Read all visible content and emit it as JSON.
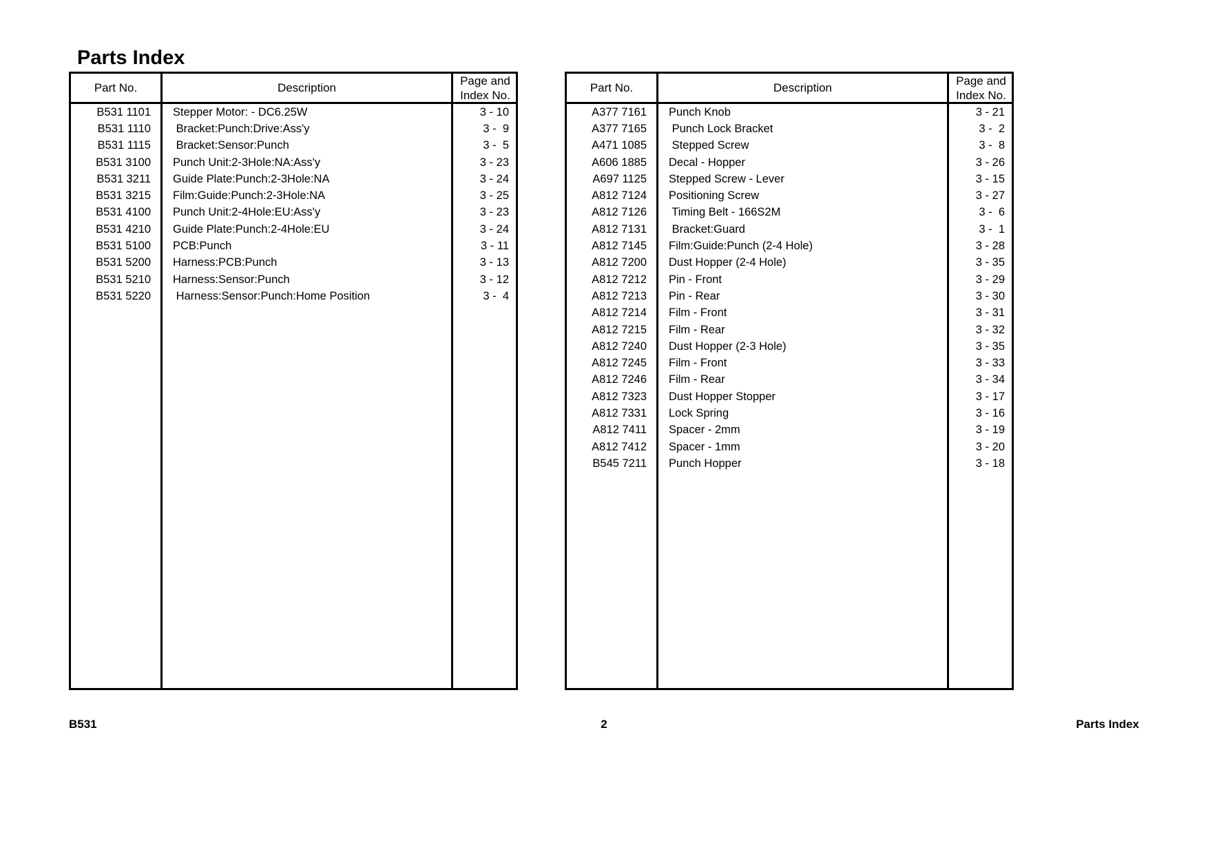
{
  "document": {
    "title": "Parts Index"
  },
  "table_headers": {
    "part_no": "Part No.",
    "description": "Description",
    "page_and_index_line1": "Page and",
    "page_and_index_line2": "Index No."
  },
  "left_table": {
    "rows": [
      {
        "part_no": "B531 1101",
        "description": "Stepper Motor: - DC6.25W",
        "page_index": "3 - 10"
      },
      {
        "part_no": "B531 1110",
        "description": " Bracket:Punch:Drive:Ass'y",
        "page_index": "3 -  9"
      },
      {
        "part_no": "B531 1115",
        "description": " Bracket:Sensor:Punch",
        "page_index": "3 -  5"
      },
      {
        "part_no": "B531 3100",
        "description": "Punch Unit:2-3Hole:NA:Ass'y",
        "page_index": "3 - 23"
      },
      {
        "part_no": "B531 3211",
        "description": "Guide Plate:Punch:2-3Hole:NA",
        "page_index": "3 - 24"
      },
      {
        "part_no": "B531 3215",
        "description": "Film:Guide:Punch:2-3Hole:NA",
        "page_index": "3 - 25"
      },
      {
        "part_no": "B531 4100",
        "description": "Punch Unit:2-4Hole:EU:Ass'y",
        "page_index": "3 - 23"
      },
      {
        "part_no": "B531 4210",
        "description": "Guide Plate:Punch:2-4Hole:EU",
        "page_index": "3 - 24"
      },
      {
        "part_no": "B531 5100",
        "description": "PCB:Punch",
        "page_index": "3 - 11"
      },
      {
        "part_no": "B531 5200",
        "description": "Harness:PCB:Punch",
        "page_index": "3 - 13"
      },
      {
        "part_no": "B531 5210",
        "description": "Harness:Sensor:Punch",
        "page_index": "3 - 12"
      },
      {
        "part_no": "B531 5220",
        "description": " Harness:Sensor:Punch:Home Position",
        "page_index": "3 -  4"
      }
    ]
  },
  "right_table": {
    "rows": [
      {
        "part_no": "A377 7161",
        "description": "Punch Knob",
        "page_index": "3 - 21"
      },
      {
        "part_no": "A377 7165",
        "description": " Punch Lock Bracket",
        "page_index": "3 -  2"
      },
      {
        "part_no": "A471 1085",
        "description": " Stepped Screw",
        "page_index": "3 -  8"
      },
      {
        "part_no": "A606 1885",
        "description": "Decal - Hopper",
        "page_index": "3 - 26"
      },
      {
        "part_no": "A697 1125",
        "description": "Stepped Screw - Lever",
        "page_index": "3 - 15"
      },
      {
        "part_no": "A812 7124",
        "description": "Positioning Screw",
        "page_index": "3 - 27"
      },
      {
        "part_no": "A812 7126",
        "description": " Timing Belt - 166S2M",
        "page_index": "3 -  6"
      },
      {
        "part_no": "A812 7131",
        "description": " Bracket:Guard",
        "page_index": "3 -  1"
      },
      {
        "part_no": "A812 7145",
        "description": "Film:Guide:Punch (2-4 Hole)",
        "page_index": "3 - 28"
      },
      {
        "part_no": "A812 7200",
        "description": "Dust Hopper (2-4 Hole)",
        "page_index": "3 - 35"
      },
      {
        "part_no": "A812 7212",
        "description": "Pin - Front",
        "page_index": "3 - 29"
      },
      {
        "part_no": "A812 7213",
        "description": "Pin - Rear",
        "page_index": "3 - 30"
      },
      {
        "part_no": "A812 7214",
        "description": "Film - Front",
        "page_index": "3 - 31"
      },
      {
        "part_no": "A812 7215",
        "description": "Film - Rear",
        "page_index": "3 - 32"
      },
      {
        "part_no": "A812 7240",
        "description": "Dust Hopper (2-3 Hole)",
        "page_index": "3 - 35"
      },
      {
        "part_no": "A812 7245",
        "description": "Film - Front",
        "page_index": "3 - 33"
      },
      {
        "part_no": "A812 7246",
        "description": "Film - Rear",
        "page_index": "3 - 34"
      },
      {
        "part_no": "A812 7323",
        "description": "Dust Hopper Stopper",
        "page_index": "3 - 17"
      },
      {
        "part_no": "A812 7331",
        "description": "Lock Spring",
        "page_index": "3 - 16"
      },
      {
        "part_no": "A812 7411",
        "description": "Spacer - 2mm",
        "page_index": "3 - 19"
      },
      {
        "part_no": "A812 7412",
        "description": "Spacer - 1mm",
        "page_index": "3 - 20"
      },
      {
        "part_no": "B545 7211",
        "description": "Punch Hopper",
        "page_index": "3 - 18"
      }
    ]
  },
  "footer": {
    "left": "B531",
    "center": "2",
    "right": "Parts Index"
  }
}
